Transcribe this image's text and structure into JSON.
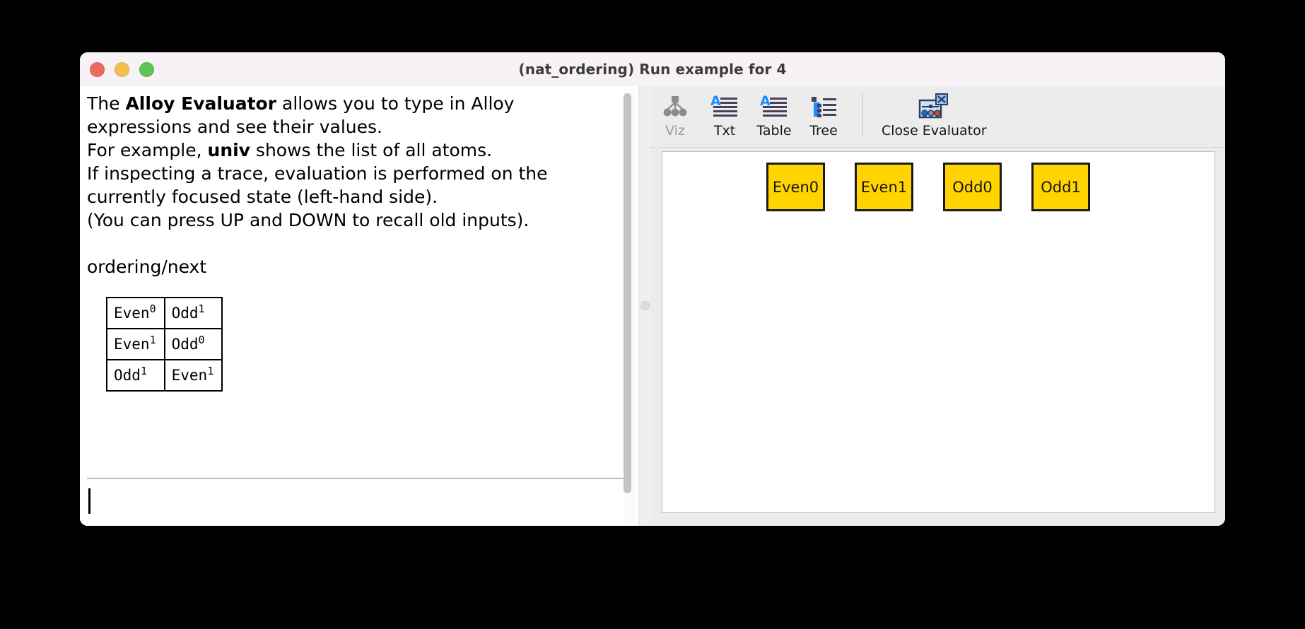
{
  "window": {
    "title": "(nat_ordering) Run example for 4",
    "traffic_lights": [
      {
        "name": "close",
        "color": "#ed6a5e"
      },
      {
        "name": "minimize",
        "color": "#f4bf50"
      },
      {
        "name": "zoom",
        "color": "#61c554"
      }
    ]
  },
  "evaluator": {
    "help_lines": [
      {
        "segments": [
          {
            "text": "The ",
            "bold": false
          },
          {
            "text": "Alloy Evaluator",
            "bold": true
          },
          {
            "text": " allows you to type in Alloy",
            "bold": false
          }
        ]
      },
      {
        "segments": [
          {
            "text": "expressions and see their values.",
            "bold": false
          }
        ]
      },
      {
        "segments": [
          {
            "text": "For example, ",
            "bold": false
          },
          {
            "text": "univ",
            "bold": true
          },
          {
            "text": " shows the list of all atoms.",
            "bold": false
          }
        ]
      },
      {
        "segments": [
          {
            "text": "If inspecting a trace, evaluation is performed on the",
            "bold": false
          }
        ]
      },
      {
        "segments": [
          {
            "text": "currently focused state (left-hand side).",
            "bold": false
          }
        ]
      },
      {
        "segments": [
          {
            "text": "(You can press UP and DOWN to recall old inputs).",
            "bold": false
          }
        ]
      }
    ],
    "last_expression": "ordering/next",
    "result_table": {
      "rows": [
        [
          {
            "name": "Even",
            "index": "0"
          },
          {
            "name": "Odd",
            "index": "1"
          }
        ],
        [
          {
            "name": "Even",
            "index": "1"
          },
          {
            "name": "Odd",
            "index": "0"
          }
        ],
        [
          {
            "name": "Odd",
            "index": "1"
          },
          {
            "name": "Even",
            "index": "1"
          }
        ]
      ]
    },
    "input_value": "",
    "input_placeholder": ""
  },
  "toolbar": {
    "buttons": [
      {
        "label": "Viz",
        "icon": "viz-graph-icon",
        "enabled": false
      },
      {
        "label": "Txt",
        "icon": "text-document-icon",
        "enabled": true
      },
      {
        "label": "Table",
        "icon": "table-document-icon",
        "enabled": true
      },
      {
        "label": "Tree",
        "icon": "tree-list-icon",
        "enabled": true
      }
    ],
    "close_evaluator": {
      "label": "Close Evaluator",
      "icon": "close-evaluator-icon",
      "enabled": true
    }
  },
  "visualization": {
    "atoms": [
      "Even0",
      "Even1",
      "Odd0",
      "Odd1"
    ],
    "atom_fill": "#ffd400",
    "atom_border": "#1a1a1a"
  }
}
